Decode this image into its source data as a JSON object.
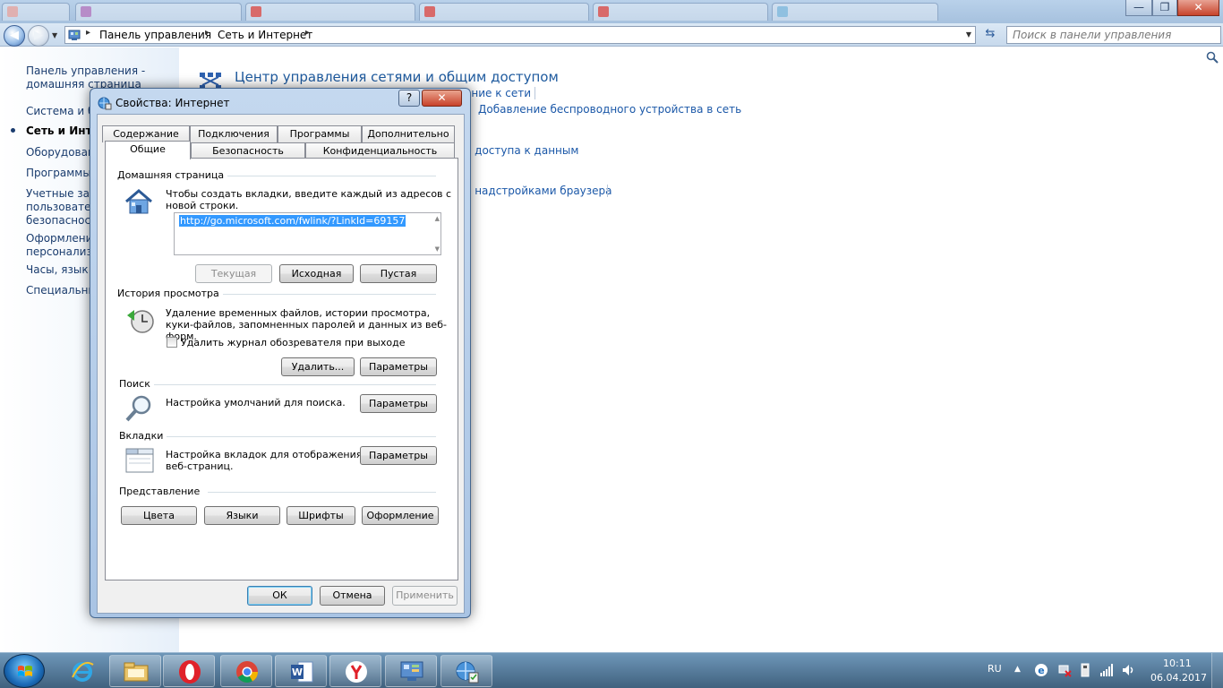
{
  "window": {
    "minimize": "—",
    "maximize": "❐",
    "close": "✕"
  },
  "address_bar": {
    "crumbs": [
      "Панель управления",
      "Сеть и Интернет"
    ],
    "search_placeholder": "Поиск в панели управления"
  },
  "left_nav": {
    "items": [
      {
        "label": "Панель управления -"
      },
      {
        "label": "домашняя страница"
      },
      {
        "label": "Система и бе"
      },
      {
        "label": "Сеть и Интер"
      },
      {
        "label": "Оборудован"
      },
      {
        "label": "Программы"
      },
      {
        "label": "Учетные запи"
      },
      {
        "label": "пользовате"
      },
      {
        "label": "безопасност"
      },
      {
        "label": "Оформление"
      },
      {
        "label": "персонализа"
      },
      {
        "label": "Часы, язык и"
      },
      {
        "label": "Специальны"
      }
    ]
  },
  "main": {
    "title": "Центр управления сетями и общим доступом",
    "links": [
      "ение к сети",
      "Добавление беспроводного устройства в сеть",
      "о доступа к данным",
      "е надстройками браузера"
    ]
  },
  "dialog": {
    "title": "Свойства: Интернет",
    "help": "?",
    "close": "✕",
    "tabs_row1": [
      "Содержание",
      "Подключения",
      "Программы",
      "Дополнительно"
    ],
    "tabs_row2": [
      "Общие",
      "Безопасность",
      "Конфиденциальность"
    ],
    "home": {
      "group": "Домашняя страница",
      "text1": "Чтобы создать вкладки, введите каждый из адресов с",
      "text2": "новой строки.",
      "url": "http://go.microsoft.com/fwlink/?LinkId=69157",
      "btn_current": "Текущая",
      "btn_default": "Исходная",
      "btn_blank": "Пустая"
    },
    "history": {
      "group": "История просмотра",
      "text1": "Удаление временных файлов, истории просмотра,",
      "text2": "куки-файлов, запомненных паролей и данных из веб-форм.",
      "checkbox": "Удалить журнал обозревателя при выходе",
      "btn_delete": "Удалить...",
      "btn_settings": "Параметры"
    },
    "search": {
      "group": "Поиск",
      "text": "Настройка умолчаний для поиска.",
      "btn_settings": "Параметры"
    },
    "tabs": {
      "group": "Вкладки",
      "text1": "Настройка вкладок для отображения",
      "text2": "веб-страниц.",
      "btn_settings": "Параметры"
    },
    "appearance": {
      "group": "Представление",
      "btn_colors": "Цвета",
      "btn_languages": "Языки",
      "btn_fonts": "Шрифты",
      "btn_accessibility": "Оформление"
    },
    "ok": "ОК",
    "cancel": "Отмена",
    "apply": "Применить"
  },
  "taskbar": {
    "lang": "RU",
    "time": "10:11",
    "date": "06.04.2017"
  },
  "colors": {
    "link": "#1b58a8",
    "title_green": "#1e5a9e",
    "selection": "#3399ff"
  }
}
